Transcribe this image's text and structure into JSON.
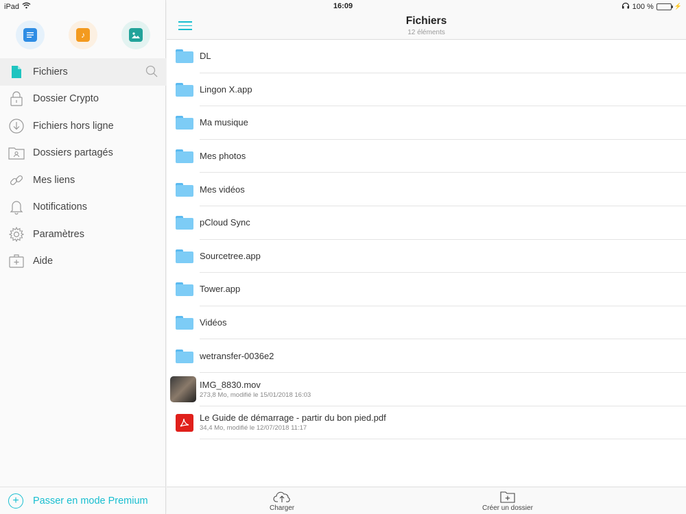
{
  "status": {
    "device": "iPad",
    "time": "16:09",
    "battery": "100 %",
    "battery_level": 1.0
  },
  "sidebar": {
    "quick": [
      {
        "name": "documents",
        "color": "#2f8de4",
        "bg": "#e5f1fb"
      },
      {
        "name": "music",
        "color": "#f39a1f",
        "bg": "#fcf0e2"
      },
      {
        "name": "photos",
        "color": "#22a39a",
        "bg": "#e3f3f1"
      }
    ],
    "items": [
      {
        "label": "Fichiers",
        "icon": "file-icon"
      },
      {
        "label": "Dossier Crypto",
        "icon": "lock-icon"
      },
      {
        "label": "Fichiers hors ligne",
        "icon": "download-icon"
      },
      {
        "label": "Dossiers partagés",
        "icon": "shared-folder-icon"
      },
      {
        "label": "Mes liens",
        "icon": "link-icon"
      },
      {
        "label": "Notifications",
        "icon": "bell-icon"
      },
      {
        "label": "Paramètres",
        "icon": "gear-icon"
      },
      {
        "label": "Aide",
        "icon": "help-icon"
      }
    ],
    "premium_label": "Passer en mode Premium",
    "accent": "#17bed0"
  },
  "main": {
    "title": "Fichiers",
    "subtitle": "12 éléments",
    "rows": [
      {
        "type": "folder",
        "name": "DL"
      },
      {
        "type": "folder",
        "name": "Lingon X.app"
      },
      {
        "type": "folder",
        "name": "Ma musique"
      },
      {
        "type": "folder",
        "name": "Mes photos"
      },
      {
        "type": "folder",
        "name": "Mes vidéos"
      },
      {
        "type": "folder",
        "name": "pCloud Sync"
      },
      {
        "type": "folder",
        "name": "Sourcetree.app"
      },
      {
        "type": "folder",
        "name": "Tower.app"
      },
      {
        "type": "folder",
        "name": "Vidéos"
      },
      {
        "type": "folder",
        "name": "wetransfer-0036e2"
      },
      {
        "type": "video",
        "name": "IMG_8830.mov",
        "meta": "273,8 Mo, modifié le 15/01/2018 16:03"
      },
      {
        "type": "pdf",
        "name": "Le Guide de démarrage - partir du bon pied.pdf",
        "meta": "34,4 Mo, modifié le 12/07/2018 11:17"
      }
    ],
    "upload_label": "Charger",
    "new_folder_label": "Créer un dossier"
  }
}
